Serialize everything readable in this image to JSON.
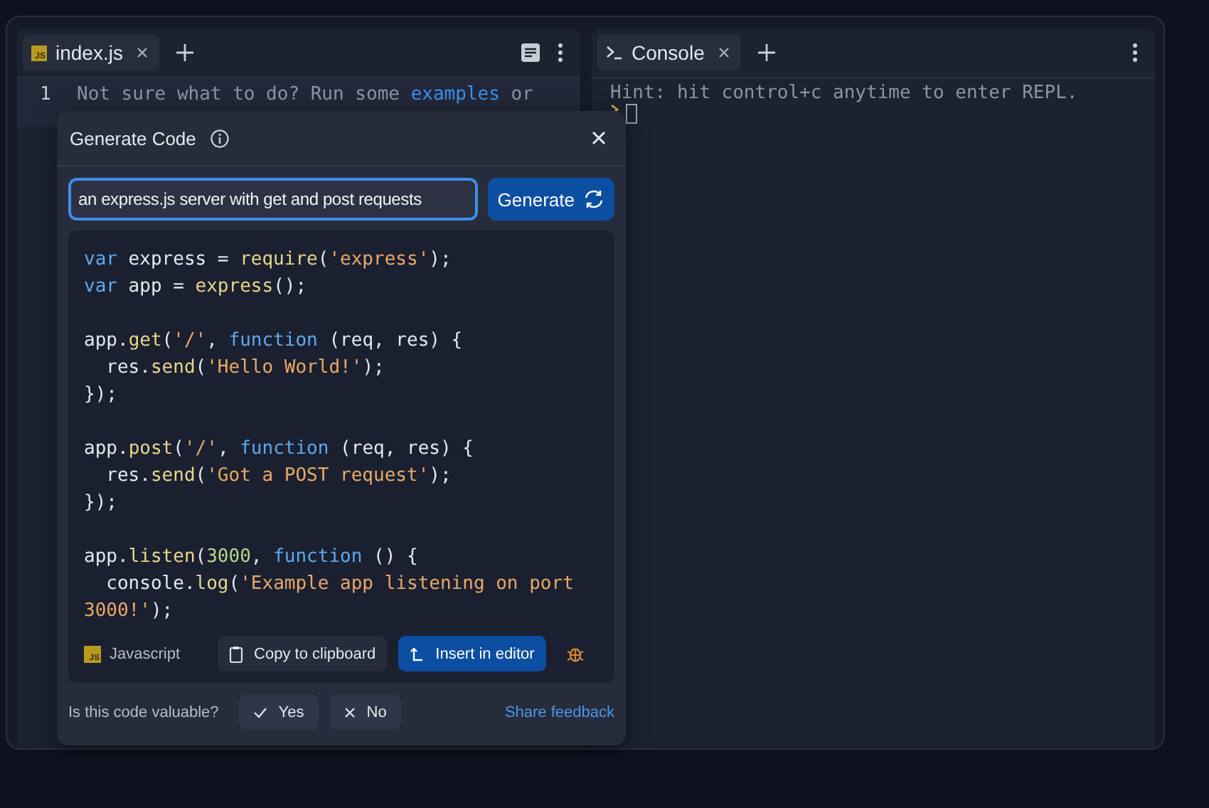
{
  "editor": {
    "tabs": [
      {
        "label": "index.js",
        "badge": "JS",
        "selected": true
      }
    ],
    "line_number": "1",
    "hint_parts": [
      {
        "kind": "text",
        "text": "Not sure what to do? Run some "
      },
      {
        "kind": "link",
        "text": "examples"
      },
      {
        "kind": "text",
        "text": " or"
      }
    ]
  },
  "console": {
    "tabs": [
      {
        "label": "Console",
        "selected": true
      }
    ],
    "hint": "Hint: hit control+c anytime to enter REPL."
  },
  "dialog": {
    "title": "Generate Code",
    "prompt": "an express.js server with get and post requests",
    "generate_label": "Generate",
    "code_lines": [
      {
        "kind": "code",
        "tokens": [
          {
            "kind": "keyword",
            "text": "var"
          },
          {
            "kind": "plain",
            "text": " express = "
          },
          {
            "kind": "function",
            "text": "require"
          },
          {
            "kind": "plain",
            "text": "("
          },
          {
            "kind": "string",
            "text": "'express'"
          },
          {
            "kind": "plain",
            "text": ");"
          }
        ]
      },
      {
        "kind": "code",
        "tokens": [
          {
            "kind": "keyword",
            "text": "var"
          },
          {
            "kind": "plain",
            "text": " app = "
          },
          {
            "kind": "function",
            "text": "express"
          },
          {
            "kind": "plain",
            "text": "();"
          }
        ]
      },
      {
        "kind": "blank"
      },
      {
        "kind": "code",
        "tokens": [
          {
            "kind": "plain",
            "text": "app."
          },
          {
            "kind": "function",
            "text": "get"
          },
          {
            "kind": "plain",
            "text": "("
          },
          {
            "kind": "string",
            "text": "'/'"
          },
          {
            "kind": "plain",
            "text": ", "
          },
          {
            "kind": "keyword",
            "text": "function"
          },
          {
            "kind": "plain",
            "text": " (req, res) {"
          }
        ]
      },
      {
        "kind": "code",
        "tokens": [
          {
            "kind": "plain",
            "text": "  res."
          },
          {
            "kind": "function",
            "text": "send"
          },
          {
            "kind": "plain",
            "text": "("
          },
          {
            "kind": "string",
            "text": "'Hello World!'"
          },
          {
            "kind": "plain",
            "text": ");"
          }
        ]
      },
      {
        "kind": "code",
        "tokens": [
          {
            "kind": "plain",
            "text": "});"
          }
        ]
      },
      {
        "kind": "blank"
      },
      {
        "kind": "code",
        "tokens": [
          {
            "kind": "plain",
            "text": "app."
          },
          {
            "kind": "function",
            "text": "post"
          },
          {
            "kind": "plain",
            "text": "("
          },
          {
            "kind": "string",
            "text": "'/'"
          },
          {
            "kind": "plain",
            "text": ", "
          },
          {
            "kind": "keyword",
            "text": "function"
          },
          {
            "kind": "plain",
            "text": " (req, res) {"
          }
        ]
      },
      {
        "kind": "code",
        "tokens": [
          {
            "kind": "plain",
            "text": "  res."
          },
          {
            "kind": "function",
            "text": "send"
          },
          {
            "kind": "plain",
            "text": "("
          },
          {
            "kind": "string",
            "text": "'Got a POST request'"
          },
          {
            "kind": "plain",
            "text": ");"
          }
        ]
      },
      {
        "kind": "code",
        "tokens": [
          {
            "kind": "plain",
            "text": "});"
          }
        ]
      },
      {
        "kind": "blank"
      },
      {
        "kind": "code",
        "tokens": [
          {
            "kind": "plain",
            "text": "app."
          },
          {
            "kind": "function",
            "text": "listen"
          },
          {
            "kind": "plain",
            "text": "("
          },
          {
            "kind": "number",
            "text": "3000"
          },
          {
            "kind": "plain",
            "text": ", "
          },
          {
            "kind": "keyword",
            "text": "function"
          },
          {
            "kind": "plain",
            "text": " () {"
          }
        ]
      },
      {
        "kind": "code",
        "tokens": [
          {
            "kind": "plain",
            "text": "  console."
          },
          {
            "kind": "function",
            "text": "log"
          },
          {
            "kind": "plain",
            "text": "("
          },
          {
            "kind": "string",
            "text": "'Example app listening on port"
          }
        ]
      },
      {
        "kind": "code",
        "tokens": [
          {
            "kind": "string",
            "text": "3000!'"
          },
          {
            "kind": "plain",
            "text": ");"
          }
        ]
      }
    ],
    "language": {
      "badge": "JS",
      "label": "Javascript"
    },
    "copy_label": "Copy to clipboard",
    "insert_label": "Insert in editor",
    "feedback": {
      "question": "Is this code valuable?",
      "yes": "Yes",
      "no": "No",
      "share": "Share feedback"
    }
  }
}
